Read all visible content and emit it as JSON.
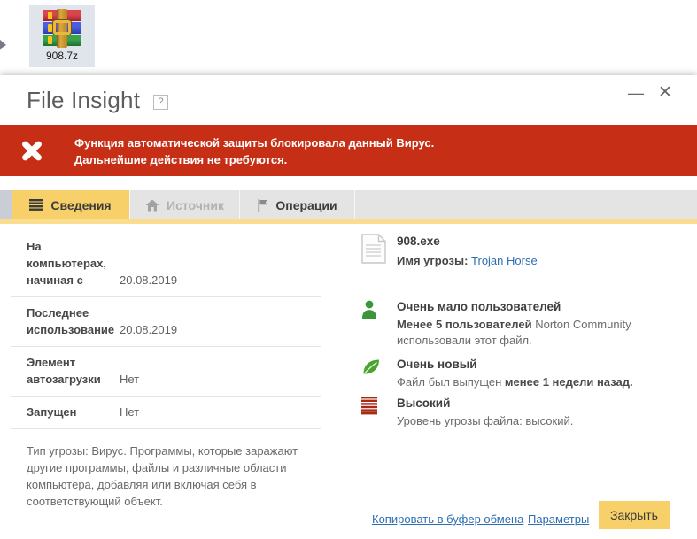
{
  "colors": {
    "banner_red": "#c62f16",
    "accent_gold": "#f8d06a",
    "strip_gold": "#fbdd8f",
    "link_blue": "#2d6fb3",
    "user_green": "#3a9639",
    "leaf_green": "#4aa52e",
    "threat_bars_red": "#a82a16"
  },
  "desktop": {
    "icon_label": "908.7z"
  },
  "titlebar": {
    "title": "File Insight",
    "help": "?",
    "minimize": "—",
    "close": "✕"
  },
  "banner": {
    "line1": "Функция автоматической защиты блокировала данный Вирус.",
    "line2": "Дальнейшие действия не требуются."
  },
  "tabs": [
    {
      "label": "Сведения",
      "state": "active"
    },
    {
      "label": "Источник",
      "state": "disabled"
    },
    {
      "label": "Операции",
      "state": "normal"
    }
  ],
  "details": {
    "rows": [
      {
        "label": "На компьютерах, начиная с",
        "value": "20.08.2019"
      },
      {
        "label": "Последнее использование",
        "value": "20.08.2019"
      },
      {
        "label": "Элемент автозагрузки",
        "value": "Нет"
      },
      {
        "label": "Запущен",
        "value": "Нет"
      }
    ],
    "description": "Тип угрозы: Вирус. Программы, которые заражают другие программы, файлы и различные области компьютера, добавляя или включая себя в соответствующий объект."
  },
  "file_info": {
    "name": "908.exe",
    "threat_label": "Имя угрозы:",
    "threat_name": "Trojan Horse"
  },
  "insights": [
    {
      "title": "Очень мало пользователей",
      "bold": "Менее 5 пользователей",
      "rest": " Norton Community использовали этот файл."
    },
    {
      "title": "Очень новый",
      "pre": "Файл был выпущен ",
      "bold": "менее 1 недели назад."
    },
    {
      "title": "Высокий",
      "text": "Уровень угрозы файла: высокий."
    }
  ],
  "footer": {
    "copy_link": "Копировать в буфер обмена",
    "settings_link": "Параметры",
    "close_button": "Закрыть"
  }
}
